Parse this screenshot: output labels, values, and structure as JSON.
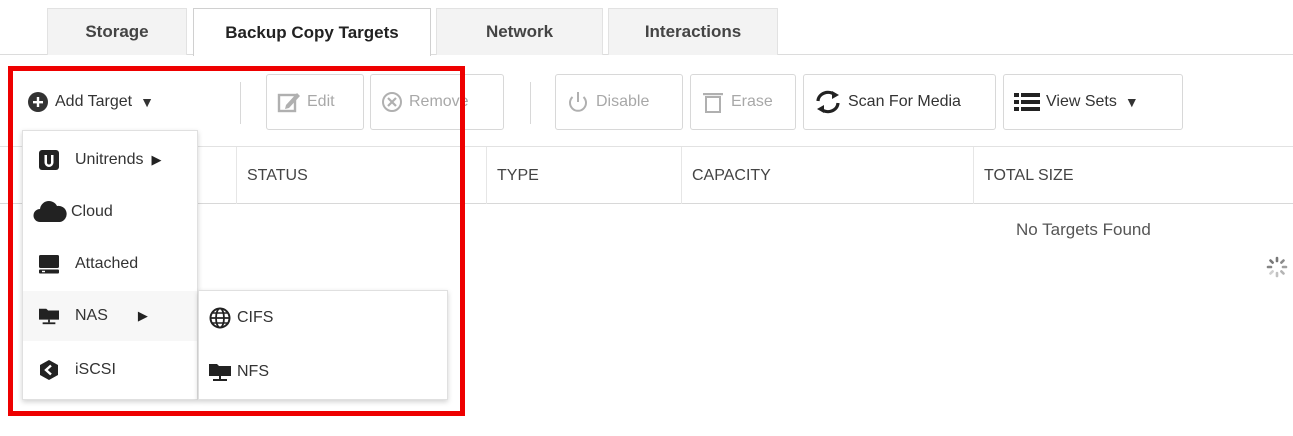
{
  "tabs": [
    {
      "label": "Storage"
    },
    {
      "label": "Backup Copy Targets"
    },
    {
      "label": "Network"
    },
    {
      "label": "Interactions"
    }
  ],
  "toolbar": {
    "add_target": "Add Target",
    "edit": "Edit",
    "remove": "Remove",
    "disable": "Disable",
    "erase": "Erase",
    "scan": "Scan For Media",
    "view_sets": "View Sets"
  },
  "table": {
    "columns": [
      "STATUS",
      "TYPE",
      "CAPACITY",
      "TOTAL SIZE"
    ],
    "empty_message": "No Targets Found"
  },
  "add_menu": {
    "items": [
      {
        "label": "Unitrends",
        "icon": "unitrends-icon",
        "submenu": true
      },
      {
        "label": "Cloud",
        "icon": "cloud-icon",
        "submenu": false
      },
      {
        "label": "Attached",
        "icon": "drive-icon",
        "submenu": false
      },
      {
        "label": "NAS",
        "icon": "nas-icon",
        "submenu": true
      },
      {
        "label": "iSCSI",
        "icon": "iscsi-icon",
        "submenu": false
      }
    ]
  },
  "nas_menu": {
    "items": [
      {
        "label": "CIFS",
        "icon": "globe-icon"
      },
      {
        "label": "NFS",
        "icon": "nas-icon"
      }
    ]
  },
  "colors": {
    "highlight": "#ee0000",
    "tab_bg": "#f3f3f3",
    "text": "#333333"
  }
}
